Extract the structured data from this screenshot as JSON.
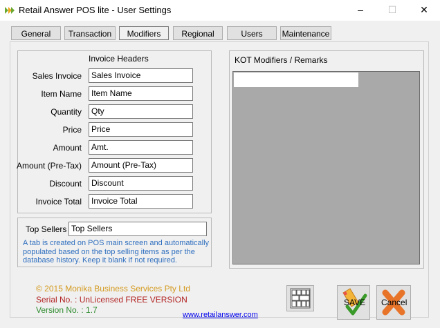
{
  "window": {
    "title": "Retail Answer POS lite - User Settings"
  },
  "tabs": [
    "General",
    "Transaction",
    "Modifiers",
    "Regional",
    "Users",
    "Maintenance"
  ],
  "active_tab": "Modifiers",
  "invoice_headers": {
    "title": "Invoice Headers",
    "rows": [
      {
        "label": "Sales Invoice",
        "value": "Sales Invoice"
      },
      {
        "label": "Item Name",
        "value": "Item Name"
      },
      {
        "label": "Quantity",
        "value": "Qty"
      },
      {
        "label": "Price",
        "value": "Price"
      },
      {
        "label": "Amount",
        "value": "Amt."
      },
      {
        "label": "Amount (Pre-Tax)",
        "value": "Amount (Pre-Tax)"
      },
      {
        "label": "Discount",
        "value": "Discount"
      },
      {
        "label": "Invoice Total",
        "value": "Invoice Total"
      }
    ]
  },
  "top_sellers": {
    "label": "Top Sellers",
    "value": "Top Sellers",
    "hint": "A tab is created on POS main screen and automatically populated based on the top selling items as per the database history. Keep it blank if not required."
  },
  "kot": {
    "title": "KOT Modifiers / Remarks",
    "input_value": ""
  },
  "footer": {
    "copyright": "© 2015 Monika Business Services Pty Ltd",
    "serial": "Serial No. : UnLicensed FREE VERSION",
    "version": "Version No. : 1.7",
    "link": "www.retailanswer.com"
  },
  "buttons": {
    "save": "SAVE",
    "cancel": "Cancel"
  },
  "colors": {
    "copyright": "#d49a1f",
    "serial": "#b22222",
    "version": "#2e8b2e",
    "hint": "#2f6fbf",
    "kot_area": "#a9a9a9"
  }
}
